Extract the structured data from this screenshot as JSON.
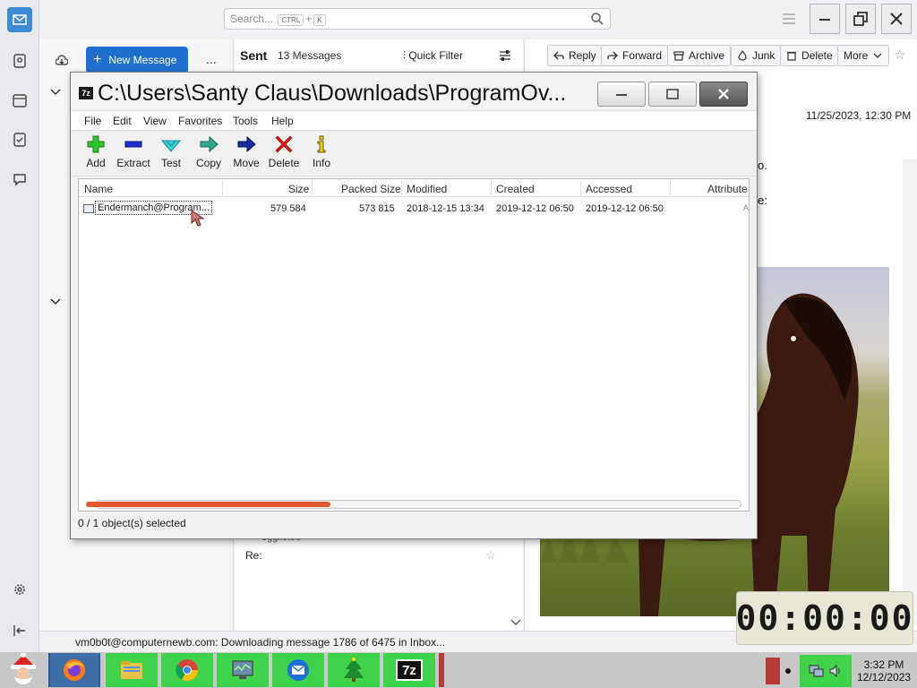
{
  "thunderbird": {
    "search_placeholder": "Search...",
    "search_kbd1": "CTRL",
    "search_plus": "+",
    "search_kbd2": "K",
    "new_message_label": "New Message",
    "more_dots": "...",
    "folder_title": "Sent",
    "message_count": "13 Messages",
    "quick_filter_label": "Quick Filter",
    "header_buttons": [
      "Reply",
      "Forward",
      "Archive",
      "Junk",
      "Delete",
      "More"
    ],
    "message_date": "11/25/2023, 12:30 PM",
    "body_fragment_1": "o.",
    "body_fragment_2": "e:",
    "thread_row_subject_fragment": "eggiisted",
    "thread_row_re": "Re:",
    "status_text": "vm0b0t@computernewb.com: Downloading message 1786 of 6475 in Inbox..."
  },
  "timer": {
    "display": "00:00:00"
  },
  "taskbar": {
    "clock_time": "3:32 PM",
    "clock_date": "12/12/2023"
  },
  "sevenzip": {
    "title": "C:\\Users\\Santy Claus\\Downloads\\ProgramOv...",
    "logo_text": "7z",
    "menu": [
      "File",
      "Edit",
      "View",
      "Favorites",
      "Tools",
      "Help"
    ],
    "toolbar": [
      "Add",
      "Extract",
      "Test",
      "Copy",
      "Move",
      "Delete",
      "Info"
    ],
    "columns": [
      "Name",
      "Size",
      "Packed Size",
      "Modified",
      "Created",
      "Accessed",
      "Attribute"
    ],
    "rows": [
      {
        "name": "Endermanch@Program...",
        "size": "579 584",
        "packed_size": "573 815",
        "modified": "2018-12-15 13:34",
        "created": "2019-12-12 06:50",
        "accessed": "2019-12-12 06:50",
        "attribute": "A"
      }
    ],
    "progress": 0.38,
    "status": "0 / 1 object(s) selected"
  },
  "colors": {
    "accent_blue": "#1f6fd1",
    "taskbar_green": "#3fd24a",
    "progress_orange": "#e2572f"
  }
}
